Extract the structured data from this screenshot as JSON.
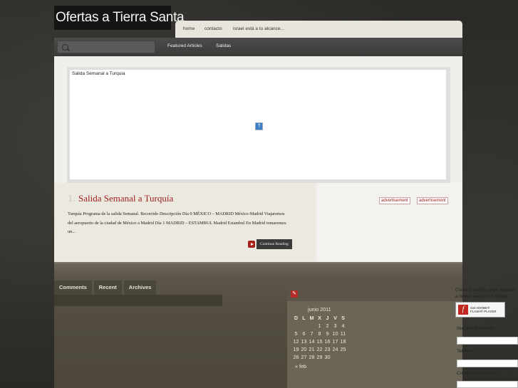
{
  "site": {
    "title": "Ofertas a Tierra Santa"
  },
  "topnav": {
    "items": [
      {
        "label": "home"
      },
      {
        "label": "contacto"
      },
      {
        "label": "israel está a tu alcance..."
      }
    ]
  },
  "navbar": {
    "search_placeholder": "",
    "links": [
      {
        "label": "Featured Articles"
      },
      {
        "label": "Salidas"
      }
    ]
  },
  "slider": {
    "title": "Salida Semanal a Turquia",
    "missing_plugin": "?"
  },
  "post": {
    "number": "1.",
    "title": "Salida Semanal a Turquía",
    "excerpt": "Turquía Programa de la salida Semanal. Recorrido Descripción Día 0 MÉXICO – MADRID México-Madrid Viajaremos del aeropuerto de la ciudad de México a Madrid Día 1 MADRID – ESTAMBUL Madrid Estambul En Madrid tomaremos un...",
    "read_more": "Continue Reading"
  },
  "ads": [
    {
      "label": "advertisement"
    },
    {
      "label": "advertisement"
    }
  ],
  "tabs": [
    {
      "label": "Comments"
    },
    {
      "label": "Recent"
    },
    {
      "label": "Archives"
    }
  ],
  "calendar": {
    "caption": "junio 2011",
    "weekdays": [
      "D",
      "L",
      "M",
      "X",
      "J",
      "V",
      "S"
    ],
    "weeks": [
      [
        "",
        "",
        "",
        "1",
        "2",
        "3",
        "4"
      ],
      [
        "5",
        "6",
        "7",
        "8",
        "9",
        "10",
        "11"
      ],
      [
        "12",
        "13",
        "14",
        "15",
        "16",
        "17",
        "18"
      ],
      [
        "19",
        "20",
        "21",
        "22",
        "23",
        "24",
        "25"
      ],
      [
        "26",
        "27",
        "28",
        "29",
        "30",
        "",
        ""
      ]
    ],
    "prev": "« feb"
  },
  "right": {
    "flash_notice": "Content on this page requires a newer version of Adobe Flash Player.",
    "flash_badge_line1": "Get ADOBE®",
    "flash_badge_line2": "FLASH® PLAYER",
    "name_label": "Nombre Completo *",
    "phone_label": "Teléfono *",
    "email_label": "Correo Electrónico *"
  },
  "colors": {
    "accent_red": "#9e1d1d",
    "dark_bg": "#2a2926",
    "paper": "#f0efe9"
  }
}
